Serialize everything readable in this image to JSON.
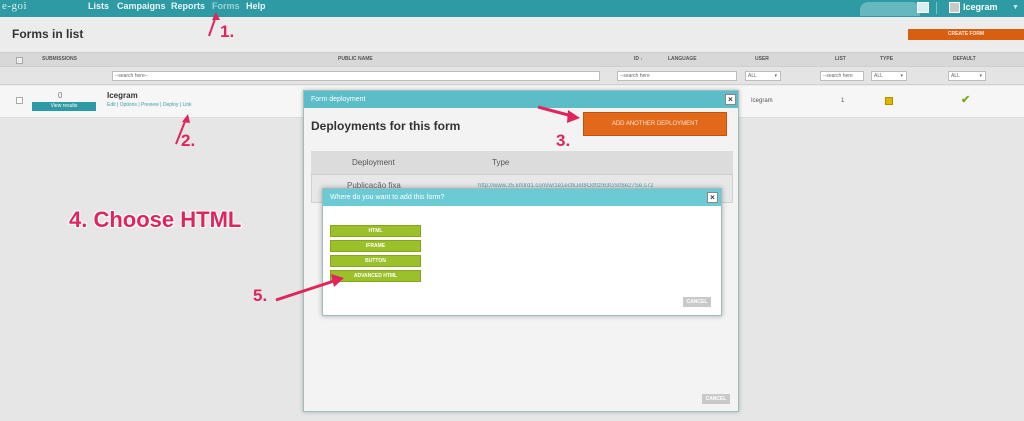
{
  "app": {
    "logo": "e-goi",
    "nav": [
      "Lists",
      "Campaigns",
      "Reports",
      "Forms",
      "Help"
    ],
    "user_name": "Icegram"
  },
  "page": {
    "title": "Forms in list",
    "create_button": "CREATE FORM",
    "columns": [
      "SUBMISSIONS",
      "PUBLIC NAME",
      "ID ↓",
      "LANGUAGE",
      "USER",
      "LIST",
      "TYPE",
      "DEFAULT"
    ],
    "filters": {
      "name_placeholder": "--search here--",
      "id_placeholder": "--search here",
      "list_placeholder": "--search here",
      "user_value": "ALL",
      "type_value": "ALL",
      "default_value": "ALL"
    },
    "row": {
      "submissions": "0",
      "view_results": "View results",
      "name": "Icegram",
      "actions": "Edit | Options | Preview | Deploy | Link",
      "user": "Icegram",
      "list": "1"
    }
  },
  "deploy_dialog": {
    "bar_title": "Form deployment",
    "heading": "Deployments for this form",
    "add_button": "ADD ANOTHER DEPLOYMENT",
    "col_deployment": "Deployment",
    "col_type": "Type",
    "row_deployment": "Publicação fixa",
    "row_type": "http://www.35.kmlrd1.com/w/1e1ecfkJeI8OdfIzI63GS08e27Se.s72",
    "cancel": "CANCEL"
  },
  "add_dialog": {
    "title": "Where do you want to add this form?",
    "options": [
      "HTML",
      "IFRAME",
      "BUTTON",
      "ADVANCED HTML"
    ],
    "cancel": "CANCEL"
  },
  "annotations": {
    "step1": "1.",
    "step2": "2.",
    "step3": "3.",
    "step4": "4. Choose HTML",
    "step5": "5."
  },
  "colors": {
    "topbar": "#2e9aa3",
    "accent_orange": "#e26919",
    "option_green": "#9cc02a",
    "annotation_pink": "#e0245e"
  }
}
